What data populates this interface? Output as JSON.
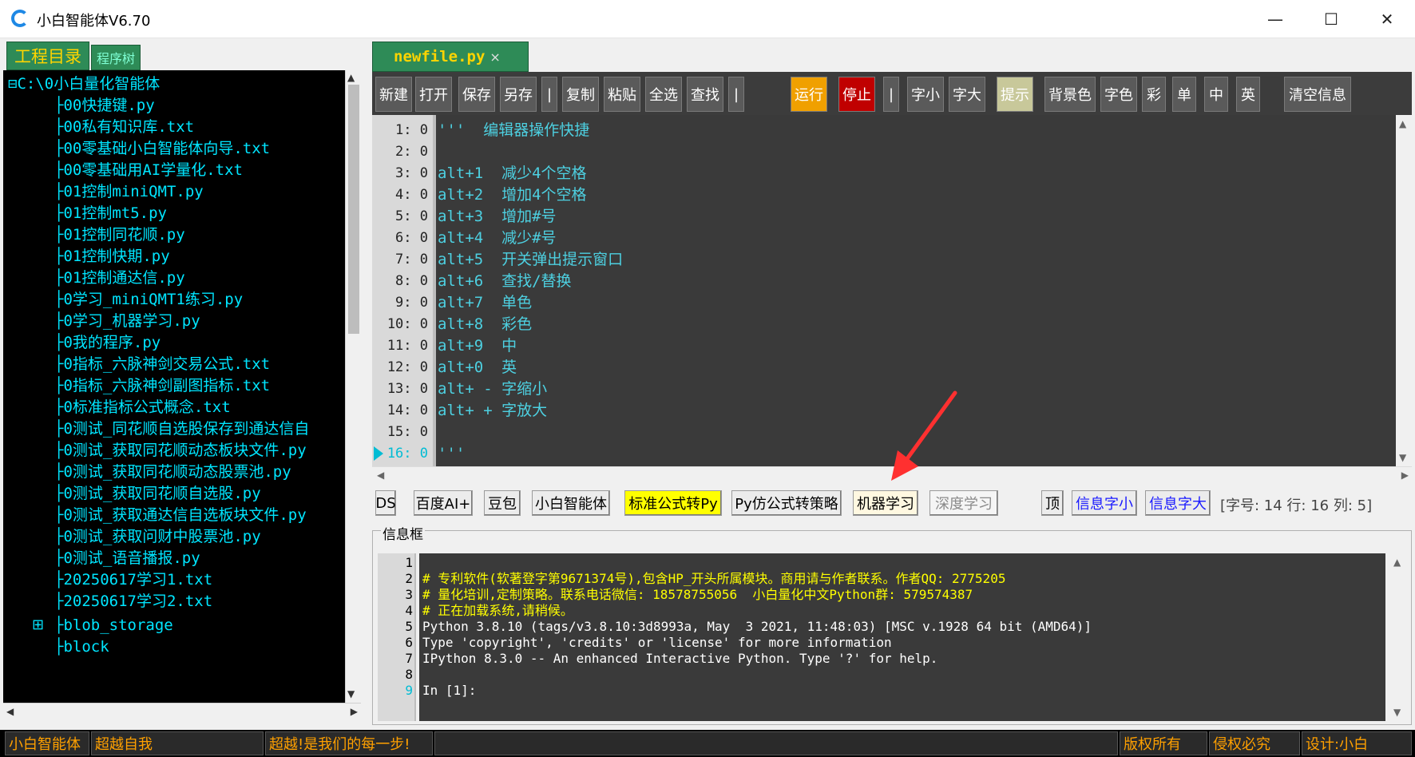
{
  "window": {
    "title": "小白智能体V6.70",
    "min_glyph": "—",
    "max_glyph": "☐",
    "close_glyph": "✕"
  },
  "left_panel": {
    "tabs": [
      "工程目录",
      "程序树"
    ],
    "root": "⊟C:\\0小白量化智能体",
    "files": [
      "├00快捷键.py",
      "├00私有知识库.txt",
      "├00零基础小白智能体向导.txt",
      "├00零基础用AI学量化.txt",
      "├01控制miniQMT.py",
      "├01控制mt5.py",
      "├01控制同花顺.py",
      "├01控制快期.py",
      "├01控制通达信.py",
      "├0学习_miniQMT1练习.py",
      "├0学习_机器学习.py",
      "├0我的程序.py",
      "├0指标_六脉神剑交易公式.txt",
      "├0指标_六脉神剑副图指标.txt",
      "├0标准指标公式概念.txt",
      "├0测试_同花顺自选股保存到通达信自",
      "├0测试_获取同花顺动态板块文件.py",
      "├0测试_获取同花顺动态股票池.py",
      "├0测试_获取同花顺自选股.py",
      "├0测试_获取通达信自选板块文件.py",
      "├0测试_获取问财中股票池.py",
      "├0测试_语音播报.py",
      "├20250617学习1.txt",
      "├20250617学习2.txt",
      "├blob_storage",
      "├block"
    ],
    "expander": "⊞"
  },
  "file_tab": {
    "name": "newfile.py",
    "close": "×"
  },
  "toolbar": {
    "new": "新建",
    "open": "打开",
    "save": "保存",
    "save_as": "另存",
    "sep": "|",
    "copy": "复制",
    "paste": "粘贴",
    "select_all": "全选",
    "find": "查找",
    "run": "运行",
    "stop": "停止",
    "font_smaller": "字小",
    "font_larger": "字大",
    "hint": "提示",
    "bg_color": "背景色",
    "font_color": "字色",
    "colorful": "彩",
    "mono": "单",
    "chinese": "中",
    "english": "英",
    "clear_info": "清空信息"
  },
  "editor": {
    "lines": [
      {
        "num": "1: 0",
        "text": "'''  编辑器操作快捷"
      },
      {
        "num": "2: 0",
        "text": ""
      },
      {
        "num": "3: 0",
        "text": "alt+1  减少4个空格"
      },
      {
        "num": "4: 0",
        "text": "alt+2  增加4个空格"
      },
      {
        "num": "5: 0",
        "text": "alt+3  增加#号"
      },
      {
        "num": "6: 0",
        "text": "alt+4  减少#号"
      },
      {
        "num": "7: 0",
        "text": "alt+5  开关弹出提示窗口"
      },
      {
        "num": "8: 0",
        "text": "alt+6  查找/替换"
      },
      {
        "num": "9: 0",
        "text": "alt+7  单色"
      },
      {
        "num": "10: 0",
        "text": "alt+8  彩色"
      },
      {
        "num": "11: 0",
        "text": "alt+9  中"
      },
      {
        "num": "12: 0",
        "text": "alt+0  英"
      },
      {
        "num": "13: 0",
        "text": "alt+ - 字缩小"
      },
      {
        "num": "14: 0",
        "text": "alt+ + 字放大"
      },
      {
        "num": "15: 0",
        "text": ""
      },
      {
        "num": "16: 0",
        "text": "'''"
      }
    ]
  },
  "ai_bar": {
    "ds": "DS",
    "baidu": "百度AI+",
    "doubao": "豆包",
    "xiaobai": "小白智能体",
    "std_formula": "标准公式转Py",
    "py_formula": "Py仿公式转策略",
    "ml": "机器学习",
    "dl": "深度学习",
    "top": "顶",
    "info_small": "信息字小",
    "info_large": "信息字大",
    "position": "[字号: 14  行: 16  列: 5]"
  },
  "info_box": {
    "label": "信息框",
    "lines": [
      {
        "num": "1",
        "text": ""
      },
      {
        "num": "2",
        "text": "# 专利软件(软著登字第9671374号),包含HP_开头所属模块。商用请与作者联系。作者QQ: 2775205"
      },
      {
        "num": "3",
        "text": "# 量化培训,定制策略。联系电话微信: 18578755056  小白量化中文Python群: 579574387"
      },
      {
        "num": "4",
        "text": "# 正在加载系统,请稍候。"
      },
      {
        "num": "5",
        "text": "Python 3.8.10 (tags/v3.8.10:3d8993a, May  3 2021, 11:48:03) [MSC v.1928 64 bit (AMD64)]"
      },
      {
        "num": "6",
        "text": "Type 'copyright', 'credits' or 'license' for more information"
      },
      {
        "num": "7",
        "text": "IPython 8.3.0 -- An enhanced Interactive Python. Type '?' for help."
      },
      {
        "num": "8",
        "text": ""
      },
      {
        "num": "9",
        "text": "In [1]:"
      }
    ]
  },
  "status_bar": {
    "cells": [
      "小白智能体",
      "超越自我",
      "超越!是我们的每一步!",
      "",
      "版权所有",
      "侵权必究",
      "设计:小白"
    ]
  },
  "scroll": {
    "up": "▲",
    "down": "▼",
    "left": "◀",
    "right": "▶"
  },
  "colors": {
    "tree_bg": "#000000",
    "tree_text": "#00e5ff",
    "editor_bg": "#3a3a3a",
    "run_btn": "#f0a000",
    "stop_btn": "#c00000",
    "status_text": "#ffa000",
    "arrow_red": "#ff3030"
  }
}
